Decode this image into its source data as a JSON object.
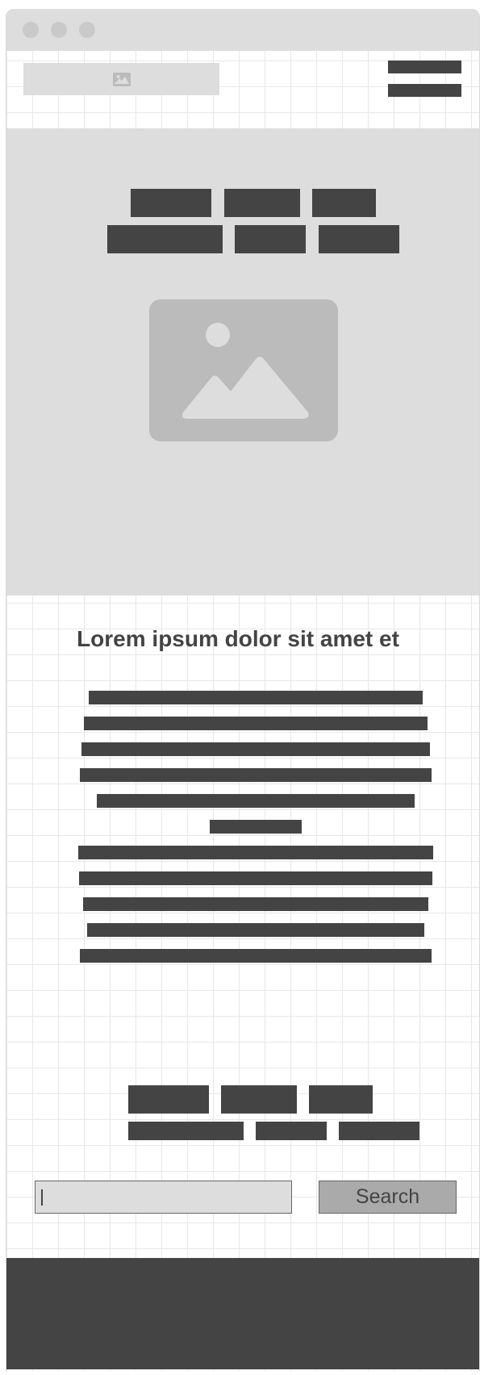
{
  "window": {
    "controls": [
      {
        "name": "close-button"
      },
      {
        "name": "minimize-button"
      },
      {
        "name": "maximize-button"
      }
    ]
  },
  "header": {
    "logo": {
      "icon": "image-placeholder-icon"
    },
    "menu": {
      "icon": "hamburger-icon"
    }
  },
  "hero": {
    "image": {
      "icon": "landscape-image-icon"
    }
  },
  "content": {
    "title": "Lorem ipsum dolor sit amet et"
  },
  "search": {
    "value": "",
    "button_label": "Search"
  },
  "colors": {
    "dark": "#444444",
    "light_gray": "#dddddd",
    "image_gray": "#bbbbbb",
    "button_gray": "#aaaaaa",
    "grid": "#e7e7e7"
  }
}
